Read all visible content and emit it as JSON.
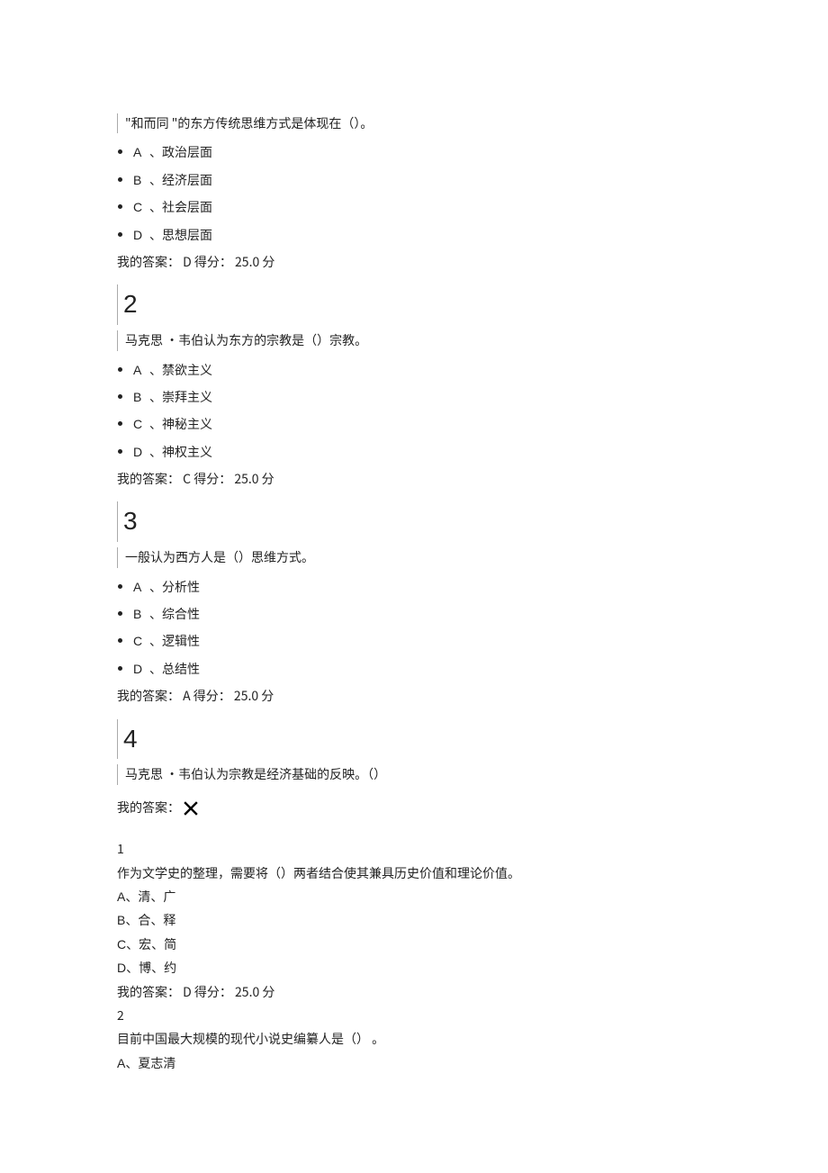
{
  "top_question": {
    "prompt": "\"和而同 \"的东方传统思维方式是体现在（）。",
    "options": [
      {
        "letter": "A",
        "text": "政治层面"
      },
      {
        "letter": "B",
        "text": "经济层面"
      },
      {
        "letter": "C",
        "text": "社会层面"
      },
      {
        "letter": "D",
        "text": "思想层面"
      }
    ],
    "answer_line": "我的答案： D 得分： 25.0 分"
  },
  "q2": {
    "number": "2",
    "prompt": "马克思 ·韦伯认为东方的宗教是（）宗教。",
    "options": [
      {
        "letter": "A",
        "text": "禁欲主义"
      },
      {
        "letter": "B",
        "text": "崇拜主义"
      },
      {
        "letter": "C",
        "text": "神秘主义"
      },
      {
        "letter": "D",
        "text": "神权主义"
      }
    ],
    "answer_line": "我的答案： C 得分： 25.0 分"
  },
  "q3": {
    "number": "3",
    "prompt": "一般认为西方人是（）思维方式。",
    "options": [
      {
        "letter": "A",
        "text": "分析性"
      },
      {
        "letter": "B",
        "text": "综合性"
      },
      {
        "letter": "C",
        "text": "逻辑性"
      },
      {
        "letter": "D",
        "text": "总结性"
      }
    ],
    "answer_line": "我的答案： A 得分： 25.0 分"
  },
  "q4": {
    "number": "4",
    "prompt": "马克思 ·韦伯认为宗教是经济基础的反映。（）",
    "answer_prefix": "我的答案：",
    "answer_icon": "x-icon"
  },
  "p1": {
    "number": "1",
    "prompt": "作为文学史的整理，需要将（）两者结合使其兼具历史价值和理论价值。",
    "options": [
      {
        "letter": "A",
        "text": "清、广"
      },
      {
        "letter": "B",
        "text": "合、释"
      },
      {
        "letter": "C",
        "text": "宏、简"
      },
      {
        "letter": "D",
        "text": "博、约"
      }
    ],
    "answer_line": "我的答案： D 得分： 25.0 分"
  },
  "p2": {
    "number": "2",
    "prompt": "目前中国最大规模的现代小说史编纂人是（）    。",
    "options": [
      {
        "letter": "A",
        "text": "夏志清"
      }
    ]
  }
}
